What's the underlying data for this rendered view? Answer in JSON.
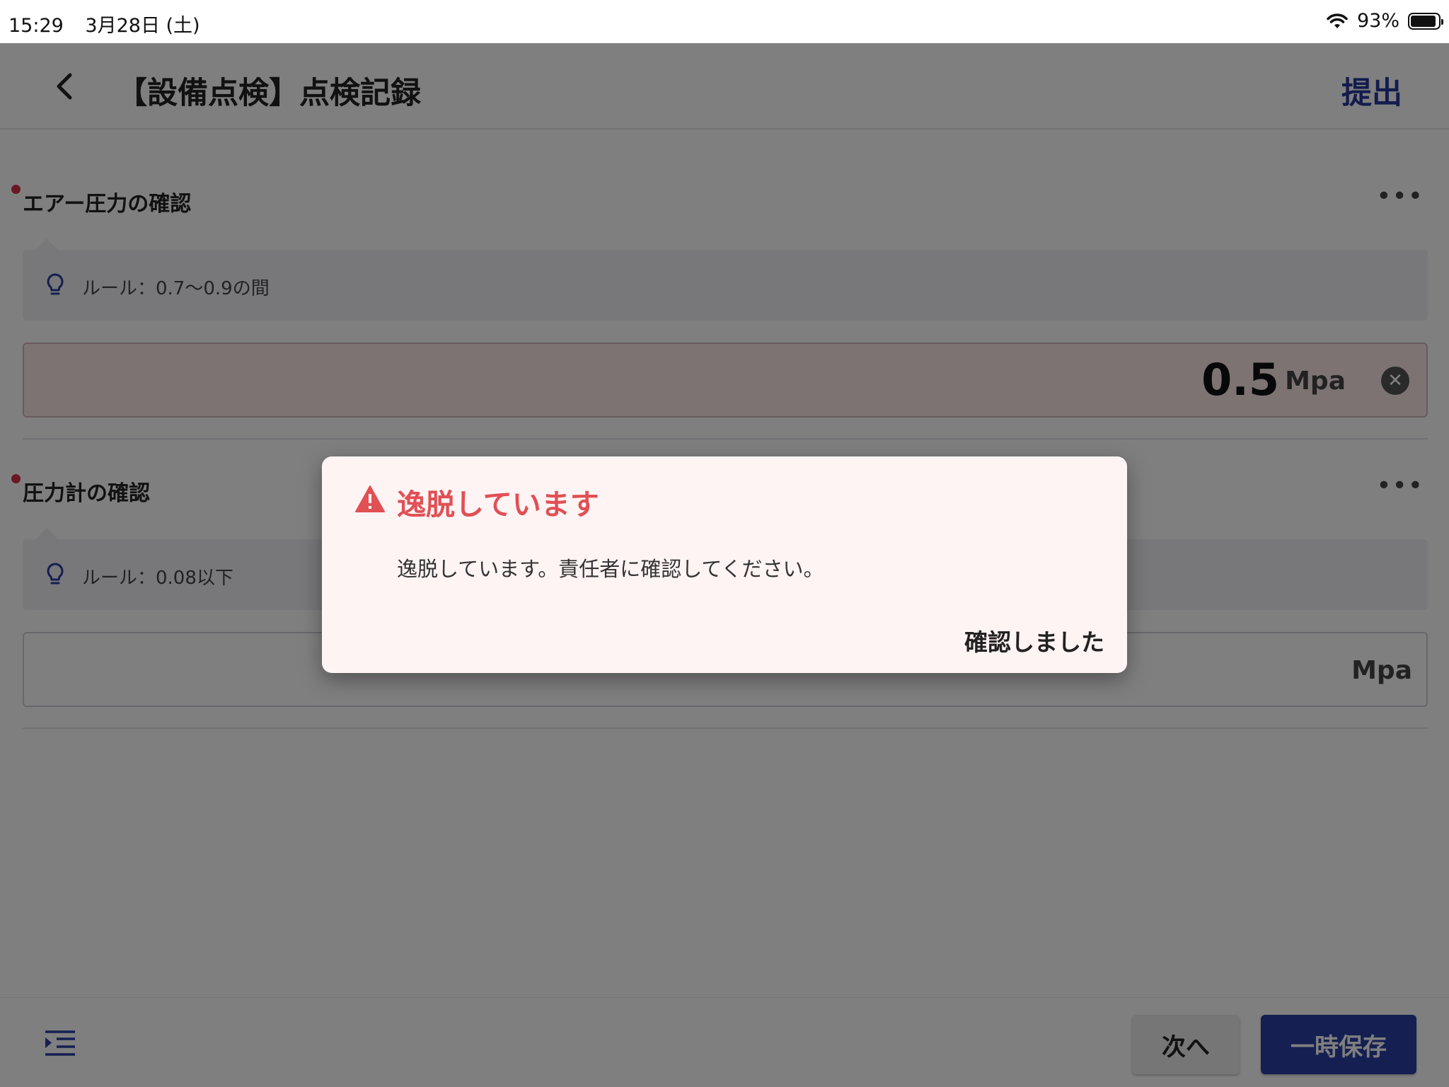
{
  "status_bar": {
    "time": "15:29",
    "date": "3月28日 (土)",
    "battery": "93%",
    "battery_level": 0.93,
    "wifi_icon": "wifi-icon"
  },
  "appbar": {
    "back_icon": "chevron-left-icon",
    "title": "【設備点検】点検記録",
    "submit_label": "提出"
  },
  "sections": [
    {
      "title": "エアー圧力の確認",
      "required": true,
      "more_label": "•••",
      "rule_text": "ルール：0.7〜0.9の間",
      "value": "0.5",
      "unit": "Mpa",
      "out_of_range": true
    },
    {
      "title": "圧力計の確認",
      "required": true,
      "more_label": "•••",
      "rule_text": "ルール：0.08以下",
      "value": "",
      "unit": "Mpa",
      "out_of_range": false
    }
  ],
  "bottom_bar": {
    "outline_icon": "outline-list-icon",
    "next_label": "次へ",
    "save_label": "一時保存"
  },
  "dialog": {
    "icon": "warning-icon",
    "title": "逸脱しています",
    "message": "逸脱しています。責任者に確認してください。",
    "confirm_label": "確認しました"
  },
  "colors": {
    "primary": "#2a3ea4",
    "error": "#e05055",
    "required_dot": "#d6304a",
    "dialog_bg": "#fff4f4"
  }
}
